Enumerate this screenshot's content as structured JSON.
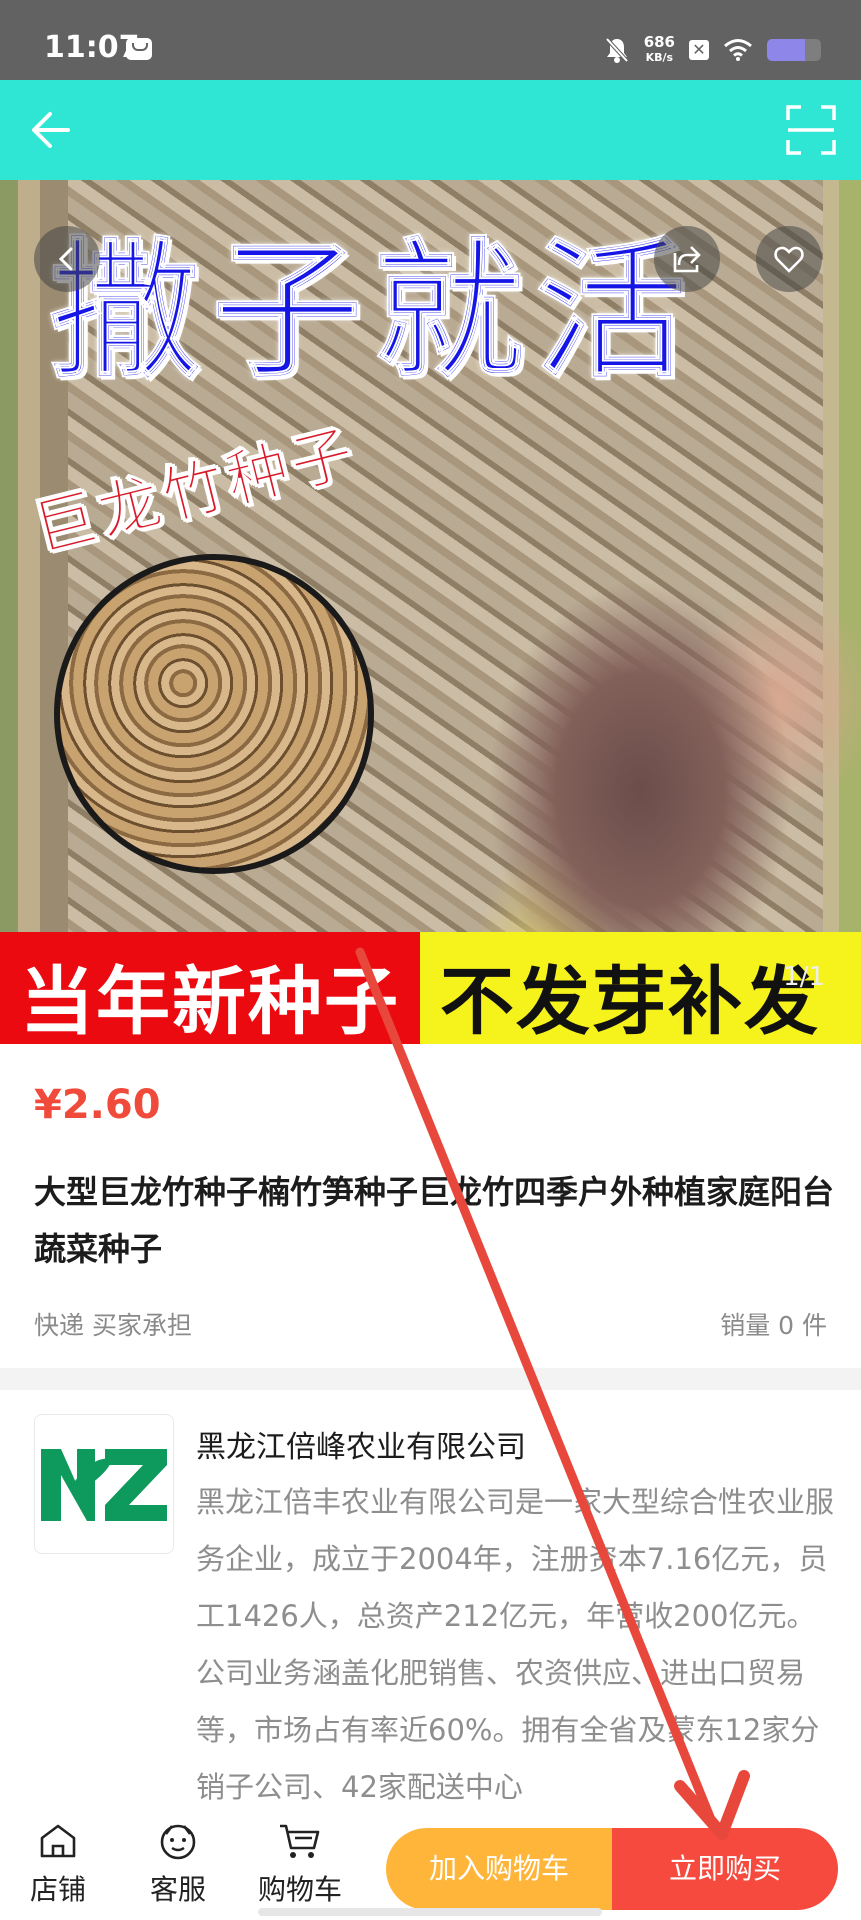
{
  "status_bar": {
    "time": "11:07",
    "speed_value": "686",
    "speed_unit": "KB/s",
    "battery_level": 0.7
  },
  "header": {
    "back_icon": "arrow-left-icon",
    "scan_icon": "scan-icon"
  },
  "hero": {
    "title": "撒子就活",
    "subtitle": "巨龙竹种子",
    "banner_left": "当年新种子",
    "banner_right": "不发芽补发",
    "page_indicator": "1/1"
  },
  "product": {
    "price": "¥2.60",
    "title": "大型巨龙竹种子楠竹笋种子巨龙竹四季户外种植家庭阳台蔬菜种子",
    "shipping": "快递 买家承担",
    "sales": "销量 0 件"
  },
  "shop": {
    "logo_text": "NZ",
    "name": "黑龙江倍峰农业有限公司",
    "description": "黑龙江倍丰农业有限公司是一家大型综合性农业服务企业，成立于2004年，注册资本7.16亿元，员工1426人，总资产212亿元，年营收200亿元。公司业务涵盖化肥销售、农资供应、进出口贸易等，市场占有率近60%。拥有全省及蒙东12家分销子公司、42家配送中心"
  },
  "bottom_bar": {
    "shop_label": "店铺",
    "service_label": "客服",
    "cart_label": "购物车",
    "add_to_cart": "加入购物车",
    "buy_now": "立即购买"
  },
  "colors": {
    "header_bg": "#2ee6d3",
    "price": "#f04a3a",
    "add_to_cart_bg": "#ffb53a",
    "buy_now_bg": "#f64a3e",
    "annotation_arrow": "#e8473c"
  }
}
